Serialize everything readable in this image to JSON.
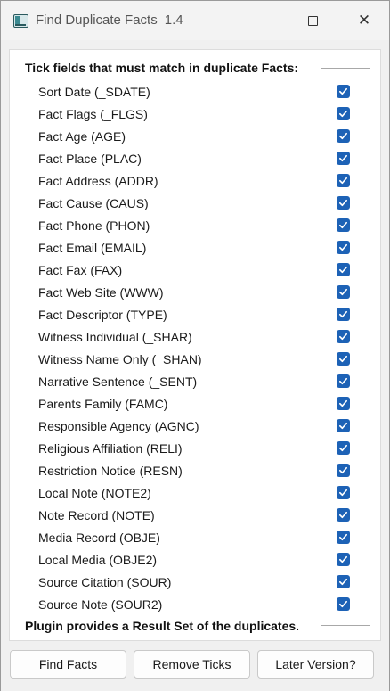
{
  "window": {
    "title": "Find Duplicate Facts",
    "version": "1.4",
    "controls": [
      "minimize",
      "maximize",
      "close"
    ]
  },
  "header": {
    "text": "Tick fields that must match in duplicate Facts:"
  },
  "fields": [
    {
      "label": "Sort Date (_SDATE)",
      "checked": true
    },
    {
      "label": "Fact Flags (_FLGS)",
      "checked": true
    },
    {
      "label": "Fact Age (AGE)",
      "checked": true
    },
    {
      "label": "Fact Place (PLAC)",
      "checked": true
    },
    {
      "label": "Fact Address (ADDR)",
      "checked": true
    },
    {
      "label": "Fact Cause (CAUS)",
      "checked": true
    },
    {
      "label": "Fact Phone (PHON)",
      "checked": true
    },
    {
      "label": "Fact Email (EMAIL)",
      "checked": true
    },
    {
      "label": "Fact Fax (FAX)",
      "checked": true
    },
    {
      "label": "Fact Web Site (WWW)",
      "checked": true
    },
    {
      "label": "Fact Descriptor (TYPE)",
      "checked": true
    },
    {
      "label": "Witness Individual (_SHAR)",
      "checked": true
    },
    {
      "label": "Witness Name Only (_SHAN)",
      "checked": true
    },
    {
      "label": "Narrative Sentence (_SENT)",
      "checked": true
    },
    {
      "label": "Parents Family (FAMC)",
      "checked": true
    },
    {
      "label": "Responsible Agency (AGNC)",
      "checked": true
    },
    {
      "label": "Religious Affiliation (RELI)",
      "checked": true
    },
    {
      "label": "Restriction Notice (RESN)",
      "checked": true
    },
    {
      "label": "Local Note (NOTE2)",
      "checked": true
    },
    {
      "label": "Note Record (NOTE)",
      "checked": true
    },
    {
      "label": "Media Record (OBJE)",
      "checked": true
    },
    {
      "label": "Local Media (OBJE2)",
      "checked": true
    },
    {
      "label": "Source Citation (SOUR)",
      "checked": true
    },
    {
      "label": "Source Note (SOUR2)",
      "checked": true
    }
  ],
  "footer": {
    "text": "Plugin provides a Result Set of the duplicates."
  },
  "buttons": {
    "find": "Find Facts",
    "remove": "Remove Ticks",
    "later": "Later Version?"
  },
  "colors": {
    "checkbox": "#1d62b6",
    "window_bg": "#f0f0f0",
    "panel_bg": "#ffffff"
  }
}
